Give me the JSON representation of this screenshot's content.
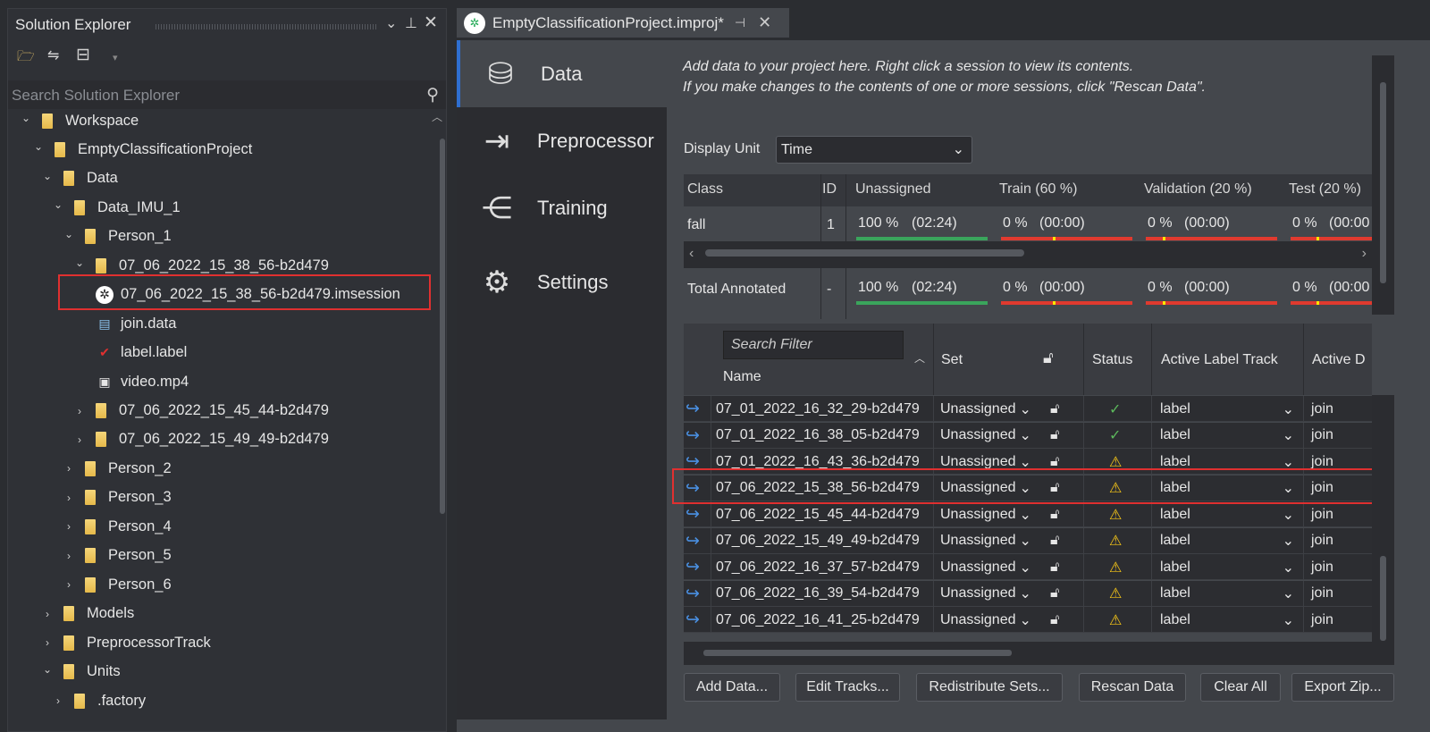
{
  "solution_explorer": {
    "title": "Solution Explorer",
    "search_placeholder": "Search Solution Explorer",
    "tree": [
      {
        "label": "Workspace",
        "level": 0,
        "type": "folder",
        "expanded": true
      },
      {
        "label": "EmptyClassificationProject",
        "level": 1,
        "type": "folder",
        "expanded": true
      },
      {
        "label": "Data",
        "level": 2,
        "type": "folder",
        "expanded": true
      },
      {
        "label": "Data_IMU_1",
        "level": 3,
        "type": "folder",
        "expanded": true
      },
      {
        "label": "Person_1",
        "level": 4,
        "type": "folder",
        "expanded": true
      },
      {
        "label": "07_06_2022_15_38_56-b2d479",
        "level": 5,
        "type": "folder",
        "expanded": true
      },
      {
        "label": "07_06_2022_15_38_56-b2d479.imsession",
        "level": 6,
        "type": "session",
        "selected": true
      },
      {
        "label": "join.data",
        "level": 6,
        "type": "data"
      },
      {
        "label": "label.label",
        "level": 6,
        "type": "label"
      },
      {
        "label": "video.mp4",
        "level": 6,
        "type": "video"
      },
      {
        "label": "07_06_2022_15_45_44-b2d479",
        "level": 5,
        "type": "folder",
        "expanded": false
      },
      {
        "label": "07_06_2022_15_49_49-b2d479",
        "level": 5,
        "type": "folder",
        "expanded": false
      },
      {
        "label": "Person_2",
        "level": 4,
        "type": "folder",
        "expanded": false
      },
      {
        "label": "Person_3",
        "level": 4,
        "type": "folder",
        "expanded": false
      },
      {
        "label": "Person_4",
        "level": 4,
        "type": "folder",
        "expanded": false
      },
      {
        "label": "Person_5",
        "level": 4,
        "type": "folder",
        "expanded": false
      },
      {
        "label": "Person_6",
        "level": 4,
        "type": "folder",
        "expanded": false
      },
      {
        "label": "Models",
        "level": 2,
        "type": "folder",
        "expanded": false
      },
      {
        "label": "PreprocessorTrack",
        "level": 2,
        "type": "folder",
        "expanded": false
      },
      {
        "label": "Units",
        "level": 2,
        "type": "folder",
        "expanded": true
      },
      {
        "label": ".factory",
        "level": 3,
        "type": "folder",
        "expanded": false
      }
    ]
  },
  "tab": {
    "title": "EmptyClassificationProject.improj*"
  },
  "nav": [
    {
      "label": "Data",
      "icon": "database-icon",
      "active": true
    },
    {
      "label": "Preprocessor",
      "icon": "enter-icon"
    },
    {
      "label": "Training",
      "icon": "network-icon"
    },
    {
      "label": "Settings",
      "icon": "gear-wrench-icon"
    }
  ],
  "intro": {
    "line1": "Add data to your project here. Right click a session to view its contents.",
    "line2": "If you make changes to the contents of one or more sessions, click \"Rescan Data\"."
  },
  "display_unit": {
    "label": "Display Unit",
    "value": "Time"
  },
  "split_table": {
    "headers": [
      "Class",
      "ID",
      "Unassigned",
      "Train (60 %)",
      "Validation (20 %)",
      "Test (20 %)"
    ],
    "rows": [
      {
        "class": "fall",
        "id": "1",
        "cells": [
          {
            "pct": "100 %",
            "time": "(02:24)",
            "fill": 100
          },
          {
            "pct": "0 %",
            "time": "(00:00)",
            "fill": 0
          },
          {
            "pct": "0 %",
            "time": "(00:00)",
            "fill": 0
          },
          {
            "pct": "0 %",
            "time": "(00:00",
            "fill": 0
          }
        ]
      }
    ],
    "total": {
      "class": "Total Annotated",
      "id": "-",
      "cells": [
        {
          "pct": "100 %",
          "time": "(02:24)",
          "fill": 100
        },
        {
          "pct": "0 %",
          "time": "(00:00)",
          "fill": 0
        },
        {
          "pct": "0 %",
          "time": "(00:00)",
          "fill": 0
        },
        {
          "pct": "0 %",
          "time": "(00:00",
          "fill": 0
        }
      ]
    }
  },
  "sessions": {
    "search_placeholder": "Search Filter",
    "headers": {
      "name": "Name",
      "set": "Set",
      "status": "Status",
      "label_track": "Active Label Track",
      "data": "Active D"
    },
    "rows": [
      {
        "name": "07_01_2022_16_32_29-b2d479",
        "set": "Unassigned",
        "status": "ok",
        "label": "label",
        "data": "join"
      },
      {
        "name": "07_01_2022_16_38_05-b2d479",
        "set": "Unassigned",
        "status": "ok",
        "label": "label",
        "data": "join"
      },
      {
        "name": "07_01_2022_16_43_36-b2d479",
        "set": "Unassigned",
        "status": "warning",
        "label": "label",
        "data": "join"
      },
      {
        "name": "07_06_2022_15_38_56-b2d479",
        "set": "Unassigned",
        "status": "warning",
        "label": "label",
        "data": "join",
        "highlighted": true
      },
      {
        "name": "07_06_2022_15_45_44-b2d479",
        "set": "Unassigned",
        "status": "warning",
        "label": "label",
        "data": "join"
      },
      {
        "name": "07_06_2022_15_49_49-b2d479",
        "set": "Unassigned",
        "status": "warning",
        "label": "label",
        "data": "join"
      },
      {
        "name": "07_06_2022_16_37_57-b2d479",
        "set": "Unassigned",
        "status": "warning",
        "label": "label",
        "data": "join"
      },
      {
        "name": "07_06_2022_16_39_54-b2d479",
        "set": "Unassigned",
        "status": "warning",
        "label": "label",
        "data": "join"
      },
      {
        "name": "07_06_2022_16_41_25-b2d479",
        "set": "Unassigned",
        "status": "warning",
        "label": "label",
        "data": "join"
      }
    ]
  },
  "buttons": [
    "Add Data...",
    "Edit Tracks...",
    "Redistribute Sets...",
    "Rescan Data",
    "Clear All",
    "Export Zip..."
  ],
  "colors": {
    "green": "#3aa55c",
    "red": "#e03a2f",
    "marker": "#ffe600",
    "highlight": "#e03030",
    "accent": "#2f6fd0"
  }
}
